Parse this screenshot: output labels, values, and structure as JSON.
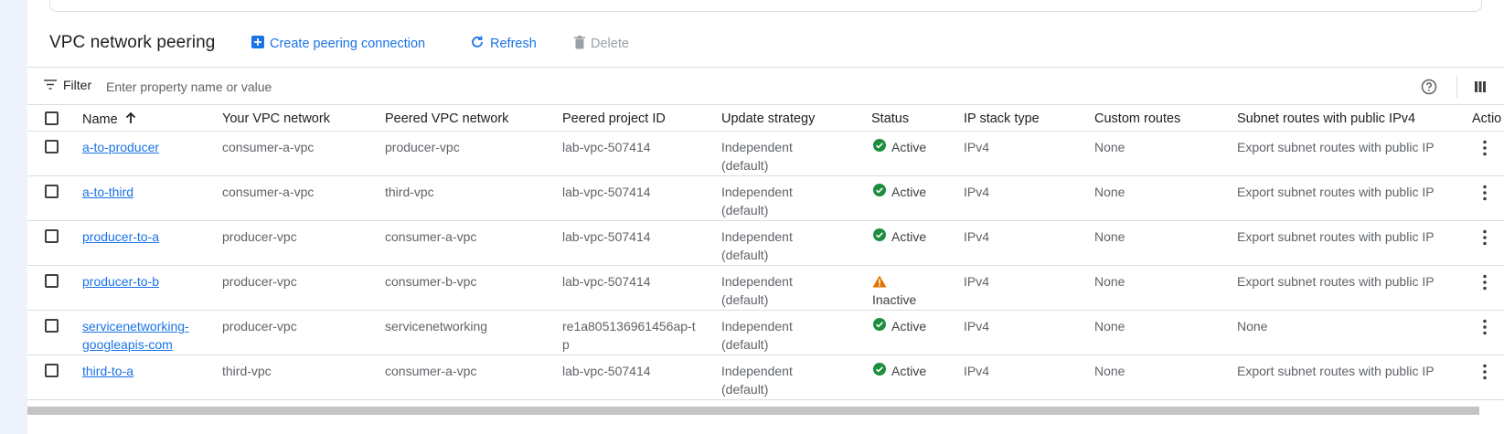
{
  "toolbar": {
    "title": "VPC network peering",
    "create_label": "Create peering connection",
    "refresh_label": "Refresh",
    "delete_label": "Delete"
  },
  "filter": {
    "label": "Filter",
    "placeholder": "Enter property name or value"
  },
  "table": {
    "headers": {
      "name": "Name",
      "your_vpc": "Your VPC network",
      "peered_vpc": "Peered VPC network",
      "peered_project": "Peered project ID",
      "update_strategy": "Update strategy",
      "status": "Status",
      "ip_stack": "IP stack type",
      "custom_routes": "Custom routes",
      "subnet_routes": "Subnet routes with public IPv4",
      "actions": "Actio"
    },
    "rows": [
      {
        "name": "a-to-producer",
        "your_vpc": "consumer-a-vpc",
        "peered_vpc": "producer-vpc",
        "peered_project": "lab-vpc-507414",
        "update_strategy": "Independent (default)",
        "status": "Active",
        "ip_stack": "IPv4",
        "custom_routes": "None",
        "subnet_routes": "Export subnet routes with public IP"
      },
      {
        "name": "a-to-third",
        "your_vpc": "consumer-a-vpc",
        "peered_vpc": "third-vpc",
        "peered_project": "lab-vpc-507414",
        "update_strategy": "Independent (default)",
        "status": "Active",
        "ip_stack": "IPv4",
        "custom_routes": "None",
        "subnet_routes": "Export subnet routes with public IP"
      },
      {
        "name": "producer-to-a",
        "your_vpc": "producer-vpc",
        "peered_vpc": "consumer-a-vpc",
        "peered_project": "lab-vpc-507414",
        "update_strategy": "Independent (default)",
        "status": "Active",
        "ip_stack": "IPv4",
        "custom_routes": "None",
        "subnet_routes": "Export subnet routes with public IP"
      },
      {
        "name": "producer-to-b",
        "your_vpc": "producer-vpc",
        "peered_vpc": "consumer-b-vpc",
        "peered_project": "lab-vpc-507414",
        "update_strategy": "Independent (default)",
        "status": "Inactive",
        "ip_stack": "IPv4",
        "custom_routes": "None",
        "subnet_routes": "Export subnet routes with public IP"
      },
      {
        "name": "servicenetworking-googleapis-com",
        "your_vpc": "producer-vpc",
        "peered_vpc": "servicenetworking",
        "peered_project": "re1a805136961456ap-tp",
        "update_strategy": "Independent (default)",
        "status": "Active",
        "ip_stack": "IPv4",
        "custom_routes": "None",
        "subnet_routes": "None"
      },
      {
        "name": "third-to-a",
        "your_vpc": "third-vpc",
        "peered_vpc": "consumer-a-vpc",
        "peered_project": "lab-vpc-507414",
        "update_strategy": "Independent (default)",
        "status": "Active",
        "ip_stack": "IPv4",
        "custom_routes": "None",
        "subnet_routes": "Export subnet routes with public IP"
      }
    ]
  },
  "colors": {
    "accent": "#1a73e8",
    "active": "#1e8e3e",
    "warning": "#e37400",
    "disabled": "#9aa0a6"
  },
  "icons": {
    "create": "add-box-icon",
    "refresh": "refresh-icon",
    "delete": "trash-icon",
    "filter": "filter-list-icon",
    "help": "help-circle-icon",
    "columns": "column-display-icon",
    "sort": "arrow-up-icon",
    "row_actions": "more-vert-icon",
    "status_active": "check-circle-icon",
    "status_inactive": "warning-icon"
  }
}
